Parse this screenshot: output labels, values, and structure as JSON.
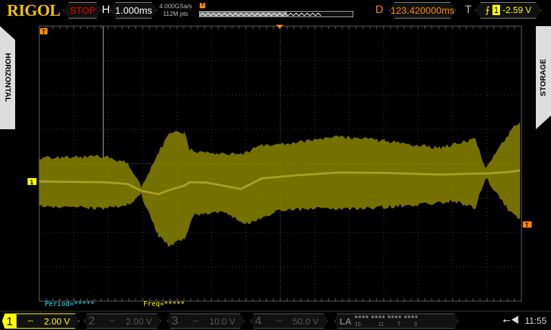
{
  "header": {
    "brand": "RIGOL",
    "run_state": "STOP",
    "h_label": "H",
    "timebase": "1.000ms",
    "sample_rate": "4.000GSa/s",
    "memory_depth": "112M pts",
    "delay_label": "D",
    "delay": "123.420000ms",
    "trigger_label": "T",
    "trigger_source": "1",
    "trigger_level": "-2.59 V",
    "trigger_edge_icon": "rising-edge-icon"
  },
  "side": {
    "left": "HORIZONTAL",
    "right": "STORAGE"
  },
  "measurements": {
    "period": "Period=*****",
    "freq": "Freq=*****"
  },
  "channels": [
    {
      "num": "1",
      "coupling": "⎓",
      "scale": "2.00 V",
      "active": true
    },
    {
      "num": "2",
      "coupling": "⎓",
      "scale": "2.00 V",
      "active": false
    },
    {
      "num": "3",
      "coupling": "⎓",
      "scale": "10.0 V",
      "active": false
    },
    {
      "num": "4",
      "coupling": "⎓",
      "scale": "50.0 V",
      "active": false
    }
  ],
  "la": {
    "label": "LA",
    "bits": [
      "15",
      "11",
      "7",
      "3"
    ]
  },
  "status": {
    "time": "11:55",
    "usb_icon": "usb-icon",
    "speaker_icon": "speaker-icon"
  },
  "markers": {
    "ch1": "1",
    "trigger": "T"
  },
  "colors": {
    "ch1": "#e8e000",
    "trace": "#8a8500",
    "delay": "#ff8800",
    "stop": "#ee0000"
  }
}
